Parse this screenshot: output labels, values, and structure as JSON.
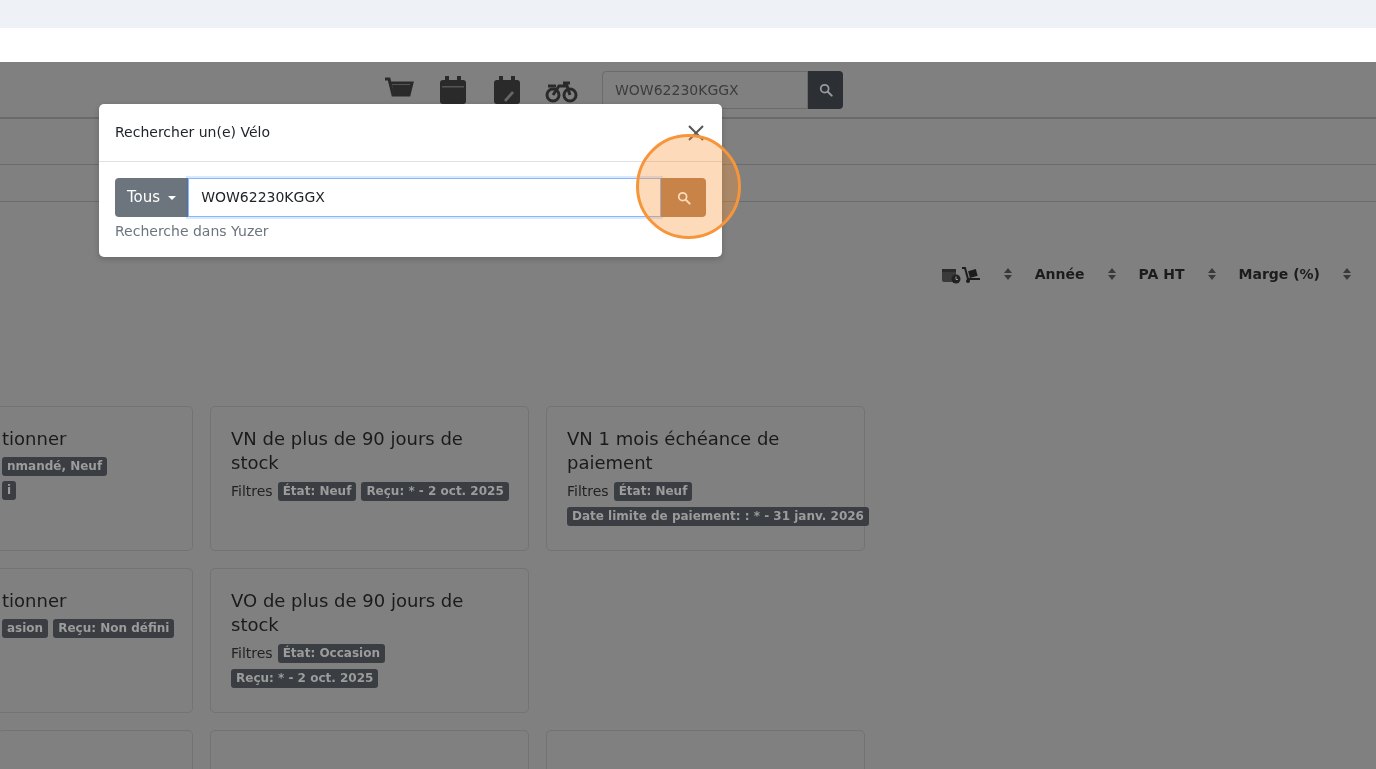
{
  "navbar": {
    "search": {
      "value": "WOW62230KGGX"
    }
  },
  "sort_bar": {
    "columns": [
      {
        "kind": "icons"
      },
      {
        "kind": "text",
        "label": "Année"
      },
      {
        "kind": "text",
        "label": "PA HT"
      },
      {
        "kind": "text",
        "label": "Marge (%)"
      }
    ]
  },
  "card_rows": [
    [
      {
        "clipped": true,
        "title": "tionner",
        "badge_lines": [
          [
            "nmandé, Neuf"
          ],
          [
            "i"
          ]
        ]
      },
      {
        "clipped": false,
        "title": "VN de plus de 90 jours de stock",
        "filters_label": "Filtres",
        "badge_lines": [
          [
            "État: Neuf",
            "Reçu: * - 2 oct. 2025"
          ]
        ]
      },
      {
        "clipped": false,
        "title": "VN 1 mois échéance de paiement",
        "filters_label": "Filtres",
        "badge_lines": [
          [
            "État: Neuf"
          ],
          [
            "Date limite de paiement: : * - 31 janv. 2026"
          ]
        ]
      }
    ],
    [
      {
        "clipped": true,
        "title": "tionner",
        "badge_lines": [
          [
            "asion",
            "Reçu: Non défini"
          ]
        ]
      },
      {
        "clipped": false,
        "title": "VO de plus de 90 jours de stock",
        "filters_label": "Filtres",
        "badge_lines": [
          [
            "État: Occasion"
          ],
          [
            "Reçu: * - 2 oct. 2025"
          ]
        ]
      }
    ]
  ],
  "modal": {
    "title": "Rechercher un(e) Vélo",
    "scope_button": "Tous",
    "value": "WOW62230KGGX",
    "hint": "Recherche dans Yuzer"
  }
}
